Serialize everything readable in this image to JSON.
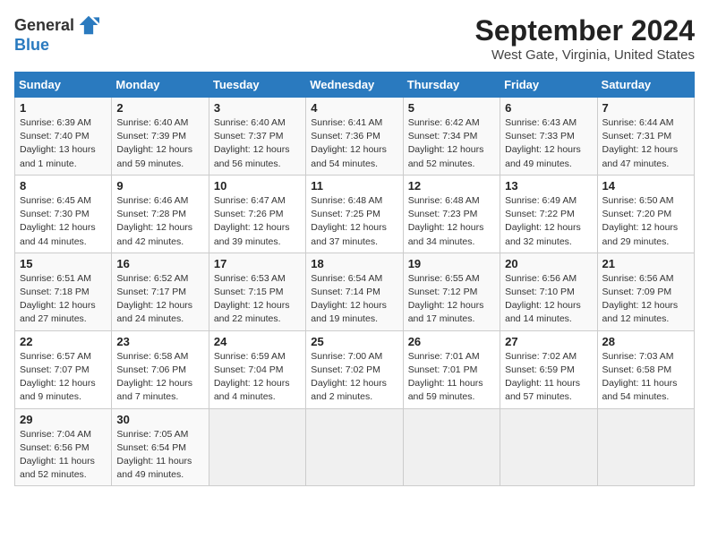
{
  "logo": {
    "general": "General",
    "blue": "Blue"
  },
  "title": "September 2024",
  "subtitle": "West Gate, Virginia, United States",
  "days_of_week": [
    "Sunday",
    "Monday",
    "Tuesday",
    "Wednesday",
    "Thursday",
    "Friday",
    "Saturday"
  ],
  "weeks": [
    [
      {
        "day": "1",
        "sunrise": "Sunrise: 6:39 AM",
        "sunset": "Sunset: 7:40 PM",
        "daylight": "Daylight: 13 hours and 1 minute."
      },
      {
        "day": "2",
        "sunrise": "Sunrise: 6:40 AM",
        "sunset": "Sunset: 7:39 PM",
        "daylight": "Daylight: 12 hours and 59 minutes."
      },
      {
        "day": "3",
        "sunrise": "Sunrise: 6:40 AM",
        "sunset": "Sunset: 7:37 PM",
        "daylight": "Daylight: 12 hours and 56 minutes."
      },
      {
        "day": "4",
        "sunrise": "Sunrise: 6:41 AM",
        "sunset": "Sunset: 7:36 PM",
        "daylight": "Daylight: 12 hours and 54 minutes."
      },
      {
        "day": "5",
        "sunrise": "Sunrise: 6:42 AM",
        "sunset": "Sunset: 7:34 PM",
        "daylight": "Daylight: 12 hours and 52 minutes."
      },
      {
        "day": "6",
        "sunrise": "Sunrise: 6:43 AM",
        "sunset": "Sunset: 7:33 PM",
        "daylight": "Daylight: 12 hours and 49 minutes."
      },
      {
        "day": "7",
        "sunrise": "Sunrise: 6:44 AM",
        "sunset": "Sunset: 7:31 PM",
        "daylight": "Daylight: 12 hours and 47 minutes."
      }
    ],
    [
      {
        "day": "8",
        "sunrise": "Sunrise: 6:45 AM",
        "sunset": "Sunset: 7:30 PM",
        "daylight": "Daylight: 12 hours and 44 minutes."
      },
      {
        "day": "9",
        "sunrise": "Sunrise: 6:46 AM",
        "sunset": "Sunset: 7:28 PM",
        "daylight": "Daylight: 12 hours and 42 minutes."
      },
      {
        "day": "10",
        "sunrise": "Sunrise: 6:47 AM",
        "sunset": "Sunset: 7:26 PM",
        "daylight": "Daylight: 12 hours and 39 minutes."
      },
      {
        "day": "11",
        "sunrise": "Sunrise: 6:48 AM",
        "sunset": "Sunset: 7:25 PM",
        "daylight": "Daylight: 12 hours and 37 minutes."
      },
      {
        "day": "12",
        "sunrise": "Sunrise: 6:48 AM",
        "sunset": "Sunset: 7:23 PM",
        "daylight": "Daylight: 12 hours and 34 minutes."
      },
      {
        "day": "13",
        "sunrise": "Sunrise: 6:49 AM",
        "sunset": "Sunset: 7:22 PM",
        "daylight": "Daylight: 12 hours and 32 minutes."
      },
      {
        "day": "14",
        "sunrise": "Sunrise: 6:50 AM",
        "sunset": "Sunset: 7:20 PM",
        "daylight": "Daylight: 12 hours and 29 minutes."
      }
    ],
    [
      {
        "day": "15",
        "sunrise": "Sunrise: 6:51 AM",
        "sunset": "Sunset: 7:18 PM",
        "daylight": "Daylight: 12 hours and 27 minutes."
      },
      {
        "day": "16",
        "sunrise": "Sunrise: 6:52 AM",
        "sunset": "Sunset: 7:17 PM",
        "daylight": "Daylight: 12 hours and 24 minutes."
      },
      {
        "day": "17",
        "sunrise": "Sunrise: 6:53 AM",
        "sunset": "Sunset: 7:15 PM",
        "daylight": "Daylight: 12 hours and 22 minutes."
      },
      {
        "day": "18",
        "sunrise": "Sunrise: 6:54 AM",
        "sunset": "Sunset: 7:14 PM",
        "daylight": "Daylight: 12 hours and 19 minutes."
      },
      {
        "day": "19",
        "sunrise": "Sunrise: 6:55 AM",
        "sunset": "Sunset: 7:12 PM",
        "daylight": "Daylight: 12 hours and 17 minutes."
      },
      {
        "day": "20",
        "sunrise": "Sunrise: 6:56 AM",
        "sunset": "Sunset: 7:10 PM",
        "daylight": "Daylight: 12 hours and 14 minutes."
      },
      {
        "day": "21",
        "sunrise": "Sunrise: 6:56 AM",
        "sunset": "Sunset: 7:09 PM",
        "daylight": "Daylight: 12 hours and 12 minutes."
      }
    ],
    [
      {
        "day": "22",
        "sunrise": "Sunrise: 6:57 AM",
        "sunset": "Sunset: 7:07 PM",
        "daylight": "Daylight: 12 hours and 9 minutes."
      },
      {
        "day": "23",
        "sunrise": "Sunrise: 6:58 AM",
        "sunset": "Sunset: 7:06 PM",
        "daylight": "Daylight: 12 hours and 7 minutes."
      },
      {
        "day": "24",
        "sunrise": "Sunrise: 6:59 AM",
        "sunset": "Sunset: 7:04 PM",
        "daylight": "Daylight: 12 hours and 4 minutes."
      },
      {
        "day": "25",
        "sunrise": "Sunrise: 7:00 AM",
        "sunset": "Sunset: 7:02 PM",
        "daylight": "Daylight: 12 hours and 2 minutes."
      },
      {
        "day": "26",
        "sunrise": "Sunrise: 7:01 AM",
        "sunset": "Sunset: 7:01 PM",
        "daylight": "Daylight: 11 hours and 59 minutes."
      },
      {
        "day": "27",
        "sunrise": "Sunrise: 7:02 AM",
        "sunset": "Sunset: 6:59 PM",
        "daylight": "Daylight: 11 hours and 57 minutes."
      },
      {
        "day": "28",
        "sunrise": "Sunrise: 7:03 AM",
        "sunset": "Sunset: 6:58 PM",
        "daylight": "Daylight: 11 hours and 54 minutes."
      }
    ],
    [
      {
        "day": "29",
        "sunrise": "Sunrise: 7:04 AM",
        "sunset": "Sunset: 6:56 PM",
        "daylight": "Daylight: 11 hours and 52 minutes."
      },
      {
        "day": "30",
        "sunrise": "Sunrise: 7:05 AM",
        "sunset": "Sunset: 6:54 PM",
        "daylight": "Daylight: 11 hours and 49 minutes."
      },
      null,
      null,
      null,
      null,
      null
    ]
  ]
}
